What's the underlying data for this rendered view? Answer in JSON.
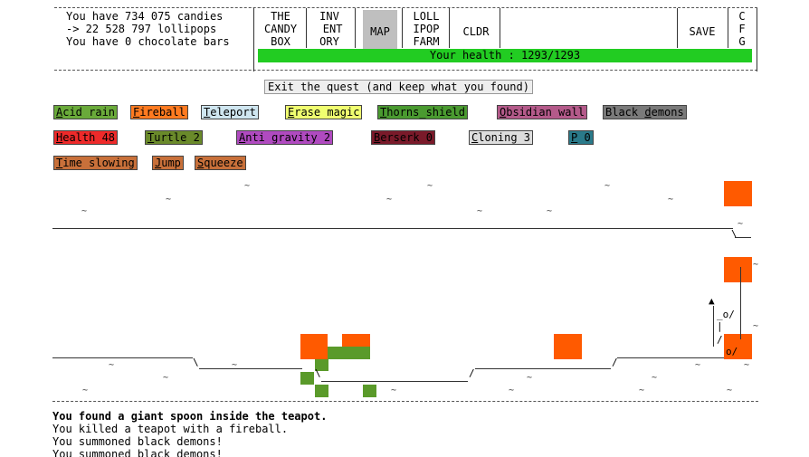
{
  "status": {
    "candies_line": "You have 734 075 candies",
    "lollipops_line": "-> 22 528 797 lollipops",
    "chocolate_line": "You have 0 chocolate bars"
  },
  "menu": {
    "candy_box": "THE\nCANDY\nBOX",
    "inventory": "INV\n ENT\nORY",
    "map": "MAP",
    "lollipop_farm": "LOLL\nIPOP\nFARM",
    "cauldron": "CLDR",
    "save": "SAVE",
    "config": "C\nF\nG"
  },
  "health": {
    "text": "Your health : 1293/1293",
    "fraction": 1.0,
    "color": "#22cc22"
  },
  "quest": {
    "exit_label": "Exit the quest (and keep what you found)"
  },
  "spells": [
    {
      "hotkey": "A",
      "rest": "cid rain",
      "color": "#6aaa3a"
    },
    {
      "hotkey": "F",
      "rest": "ireball",
      "color": "#ff7a20"
    },
    {
      "hotkey": "T",
      "rest": "eleport",
      "color": "#cfe6f0"
    },
    {
      "hotkey": "E",
      "rest": "rase magic",
      "color": "#f0ff70"
    },
    {
      "hotkey": "T",
      "rest": "horns_shield",
      "color": "#4a9a30"
    },
    {
      "hotkey": "O",
      "rest": "bsidian wall",
      "color": "#b45a8a"
    },
    {
      "hotkey": "",
      "rest": "Black demons",
      "color": "#7a7a7a",
      "plain_prefix": "Black ",
      "hk2": "d",
      "rest2": "emons"
    },
    {
      "hotkey": "H",
      "rest": "ealth 48",
      "color": "#ee2a2a"
    },
    {
      "hotkey": "T",
      "rest": "urtle 2",
      "color": "#6a8a2a"
    },
    {
      "hotkey": "A",
      "rest": "nti gravity 2",
      "color": "#b04ac0"
    },
    {
      "hotkey": "B",
      "rest": "erserk 0",
      "color": "#7a1a2a"
    },
    {
      "hotkey": "C",
      "rest": "loning 3",
      "color": "#dddddd"
    },
    {
      "hotkey": "P",
      "rest": " 0",
      "color": "#2a7a8a"
    },
    {
      "hotkey": "T",
      "rest": "ime slowing",
      "color": "#c8703a"
    },
    {
      "hotkey": "J",
      "rest": "ump",
      "color": "#c8703a"
    },
    {
      "hotkey": "S",
      "rest": "queeze",
      "color": "#c8703a"
    }
  ],
  "map_glyphs": {
    "tilde": "~",
    "arrow_up": "▲",
    "player_head": "_o/",
    "player_body": "/ \\",
    "player_low": "o/"
  },
  "colors": {
    "lava": "#ff5a00",
    "demon": "#5a9a2a"
  },
  "log": [
    "You found a giant spoon inside the teapot.",
    "You killed a teapot with a fireball.",
    "You summoned black demons!",
    "You summoned black demons!"
  ]
}
